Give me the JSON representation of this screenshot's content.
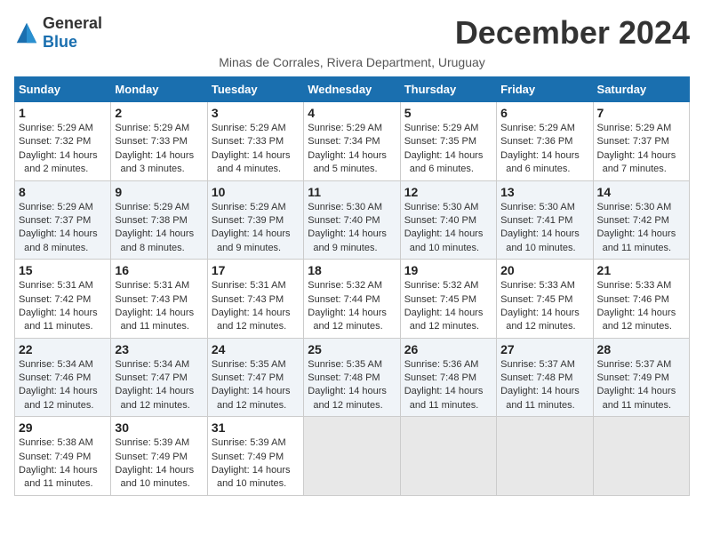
{
  "header": {
    "logo_general": "General",
    "logo_blue": "Blue",
    "month_title": "December 2024",
    "subtitle": "Minas de Corrales, Rivera Department, Uruguay"
  },
  "weekdays": [
    "Sunday",
    "Monday",
    "Tuesday",
    "Wednesday",
    "Thursday",
    "Friday",
    "Saturday"
  ],
  "weeks": [
    [
      {
        "day": "1",
        "sunrise": "5:29 AM",
        "sunset": "7:32 PM",
        "daylight": "14 hours and 2 minutes."
      },
      {
        "day": "2",
        "sunrise": "5:29 AM",
        "sunset": "7:33 PM",
        "daylight": "14 hours and 3 minutes."
      },
      {
        "day": "3",
        "sunrise": "5:29 AM",
        "sunset": "7:33 PM",
        "daylight": "14 hours and 4 minutes."
      },
      {
        "day": "4",
        "sunrise": "5:29 AM",
        "sunset": "7:34 PM",
        "daylight": "14 hours and 5 minutes."
      },
      {
        "day": "5",
        "sunrise": "5:29 AM",
        "sunset": "7:35 PM",
        "daylight": "14 hours and 6 minutes."
      },
      {
        "day": "6",
        "sunrise": "5:29 AM",
        "sunset": "7:36 PM",
        "daylight": "14 hours and 6 minutes."
      },
      {
        "day": "7",
        "sunrise": "5:29 AM",
        "sunset": "7:37 PM",
        "daylight": "14 hours and 7 minutes."
      }
    ],
    [
      {
        "day": "8",
        "sunrise": "5:29 AM",
        "sunset": "7:37 PM",
        "daylight": "14 hours and 8 minutes."
      },
      {
        "day": "9",
        "sunrise": "5:29 AM",
        "sunset": "7:38 PM",
        "daylight": "14 hours and 8 minutes."
      },
      {
        "day": "10",
        "sunrise": "5:29 AM",
        "sunset": "7:39 PM",
        "daylight": "14 hours and 9 minutes."
      },
      {
        "day": "11",
        "sunrise": "5:30 AM",
        "sunset": "7:40 PM",
        "daylight": "14 hours and 9 minutes."
      },
      {
        "day": "12",
        "sunrise": "5:30 AM",
        "sunset": "7:40 PM",
        "daylight": "14 hours and 10 minutes."
      },
      {
        "day": "13",
        "sunrise": "5:30 AM",
        "sunset": "7:41 PM",
        "daylight": "14 hours and 10 minutes."
      },
      {
        "day": "14",
        "sunrise": "5:30 AM",
        "sunset": "7:42 PM",
        "daylight": "14 hours and 11 minutes."
      }
    ],
    [
      {
        "day": "15",
        "sunrise": "5:31 AM",
        "sunset": "7:42 PM",
        "daylight": "14 hours and 11 minutes."
      },
      {
        "day": "16",
        "sunrise": "5:31 AM",
        "sunset": "7:43 PM",
        "daylight": "14 hours and 11 minutes."
      },
      {
        "day": "17",
        "sunrise": "5:31 AM",
        "sunset": "7:43 PM",
        "daylight": "14 hours and 12 minutes."
      },
      {
        "day": "18",
        "sunrise": "5:32 AM",
        "sunset": "7:44 PM",
        "daylight": "14 hours and 12 minutes."
      },
      {
        "day": "19",
        "sunrise": "5:32 AM",
        "sunset": "7:45 PM",
        "daylight": "14 hours and 12 minutes."
      },
      {
        "day": "20",
        "sunrise": "5:33 AM",
        "sunset": "7:45 PM",
        "daylight": "14 hours and 12 minutes."
      },
      {
        "day": "21",
        "sunrise": "5:33 AM",
        "sunset": "7:46 PM",
        "daylight": "14 hours and 12 minutes."
      }
    ],
    [
      {
        "day": "22",
        "sunrise": "5:34 AM",
        "sunset": "7:46 PM",
        "daylight": "14 hours and 12 minutes."
      },
      {
        "day": "23",
        "sunrise": "5:34 AM",
        "sunset": "7:47 PM",
        "daylight": "14 hours and 12 minutes."
      },
      {
        "day": "24",
        "sunrise": "5:35 AM",
        "sunset": "7:47 PM",
        "daylight": "14 hours and 12 minutes."
      },
      {
        "day": "25",
        "sunrise": "5:35 AM",
        "sunset": "7:48 PM",
        "daylight": "14 hours and 12 minutes."
      },
      {
        "day": "26",
        "sunrise": "5:36 AM",
        "sunset": "7:48 PM",
        "daylight": "14 hours and 11 minutes."
      },
      {
        "day": "27",
        "sunrise": "5:37 AM",
        "sunset": "7:48 PM",
        "daylight": "14 hours and 11 minutes."
      },
      {
        "day": "28",
        "sunrise": "5:37 AM",
        "sunset": "7:49 PM",
        "daylight": "14 hours and 11 minutes."
      }
    ],
    [
      {
        "day": "29",
        "sunrise": "5:38 AM",
        "sunset": "7:49 PM",
        "daylight": "14 hours and 11 minutes."
      },
      {
        "day": "30",
        "sunrise": "5:39 AM",
        "sunset": "7:49 PM",
        "daylight": "14 hours and 10 minutes."
      },
      {
        "day": "31",
        "sunrise": "5:39 AM",
        "sunset": "7:49 PM",
        "daylight": "14 hours and 10 minutes."
      },
      null,
      null,
      null,
      null
    ]
  ],
  "labels": {
    "sunrise": "Sunrise:",
    "sunset": "Sunset:",
    "daylight": "Daylight:"
  }
}
